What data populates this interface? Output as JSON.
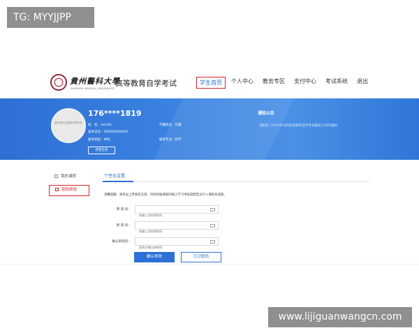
{
  "overlay": {
    "tag": "TG: MYYJJPP",
    "watermark": "www.lijiguanwangcn.com"
  },
  "header": {
    "logo_cn": "貴州醫科大學",
    "logo_en": "GUIZHOU MEDICAL UNIVERSITY",
    "title": "高等教育自学考试",
    "nav": [
      {
        "label": "学生首页",
        "active": true
      },
      {
        "label": "个人中心"
      },
      {
        "label": "教务专区"
      },
      {
        "label": "支付中心"
      },
      {
        "label": "考试系统"
      },
      {
        "label": "退出"
      }
    ]
  },
  "profile": {
    "avatar_text": "图片暂未加载或加载失败",
    "phone": "176****1819",
    "name_label": "姓　名：",
    "name_value": "cehs01",
    "ticket_label": "准考证号：",
    "ticket_value": "000000000000",
    "level_label": "报考类型：",
    "level_value": "本科",
    "status_label": "学籍状态：",
    "status_value": "在籍",
    "major_label": "报考专业：",
    "major_value": "药学",
    "complete_button": "完善信息"
  },
  "notice": {
    "title": "通知公告",
    "item": "【报名】2016年10月高等教育自学考试报名工作的通知"
  },
  "menu": {
    "items": [
      {
        "label": "我的课程"
      },
      {
        "label": "密码修改",
        "active": true
      }
    ]
  },
  "content": {
    "tab": "个性化设置",
    "tip": "温馨提醒：请务必上传真实信息，否则所报课程的网上学习考核成绩无法计入课程总成绩。",
    "fields": [
      {
        "label": "原 密 码：",
        "placeholder": "请输入您的原密码"
      },
      {
        "label": "新 密 码：",
        "placeholder": "请输入您的新密码"
      },
      {
        "label": "确认新密码：",
        "placeholder": "请再次确认新密码"
      }
    ],
    "confirm_button": "确认修改",
    "forgot_button": "忘记密码"
  },
  "colors": {
    "primary": "#2c6fd6",
    "highlight": "#d6232a",
    "banner": "#3a82e0"
  }
}
